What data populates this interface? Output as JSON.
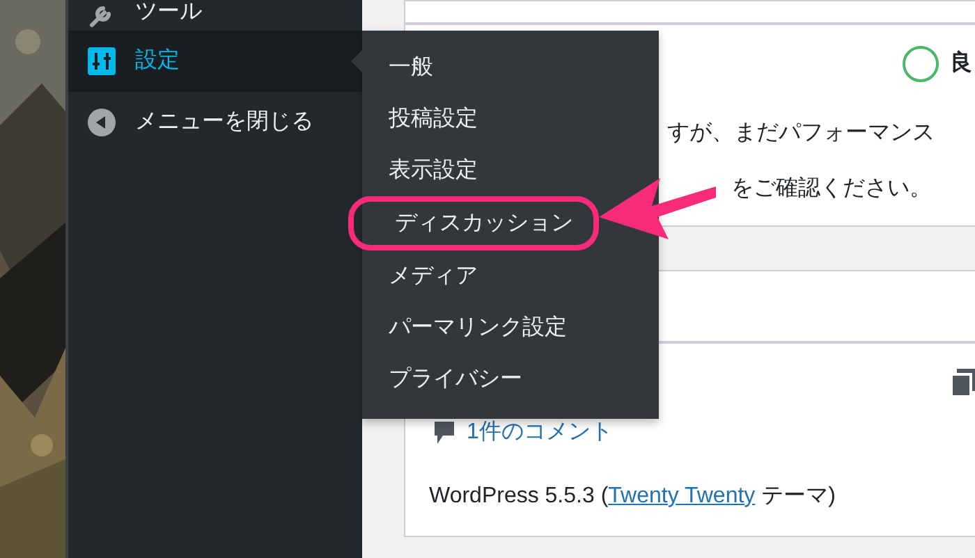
{
  "sidebar": {
    "items": [
      {
        "label": "ツール",
        "selected": false
      },
      {
        "label": "設定",
        "selected": true
      },
      {
        "label": "メニューを閉じる",
        "selected": false
      }
    ]
  },
  "flyout": {
    "items": [
      {
        "label": "一般",
        "annotated": false
      },
      {
        "label": "投稿設定",
        "annotated": false
      },
      {
        "label": "表示設定",
        "annotated": false
      },
      {
        "label": "ディスカッション",
        "annotated": true
      },
      {
        "label": "メディア",
        "annotated": false
      },
      {
        "label": "パーマリンク設定",
        "annotated": false
      },
      {
        "label": "プライバシー",
        "annotated": false
      }
    ]
  },
  "health_card": {
    "status": "良",
    "lines": [
      "すが、まだパフォーマンス",
      "をご確認ください。"
    ]
  },
  "glance_card": {
    "comments": "1件のコメント",
    "version_prefix": "WordPress 5.5.3 (",
    "theme_link": "Twenty Twenty",
    "version_suffix": " テーマ)"
  }
}
